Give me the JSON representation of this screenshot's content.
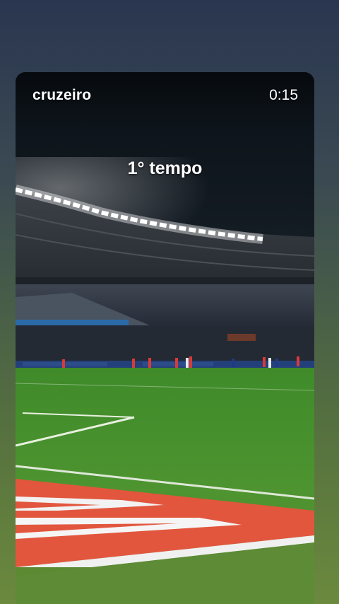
{
  "story": {
    "username": "cruzeiro",
    "timestamp": "0:15",
    "caption": "1° tempo"
  }
}
